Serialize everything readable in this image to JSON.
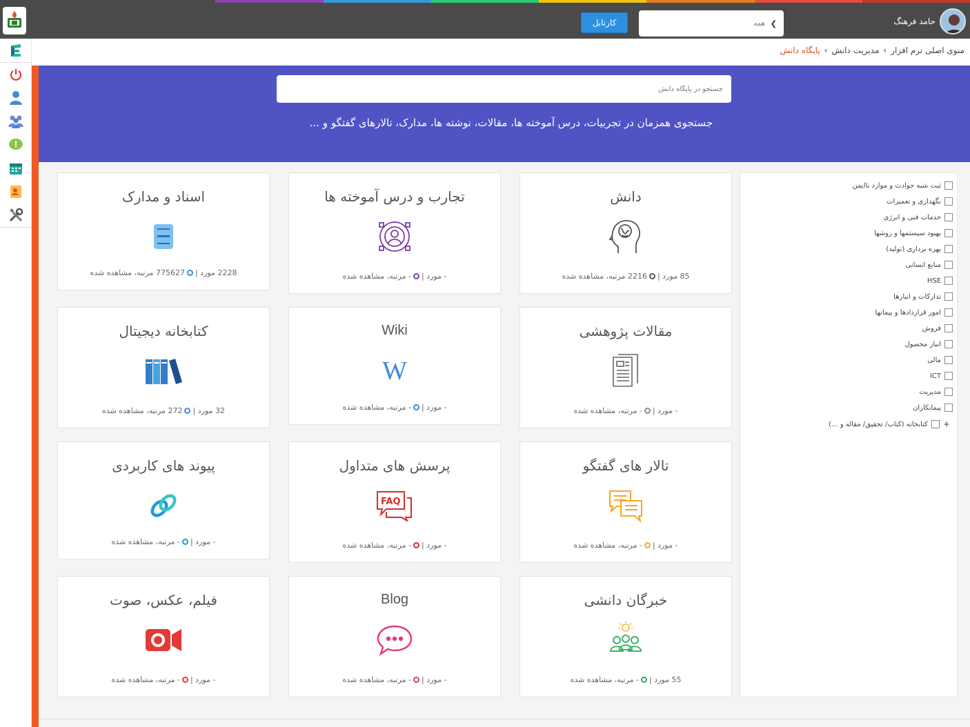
{
  "colors": {
    "rainbow": [
      "#4a4a4a",
      "#8e44ad",
      "#3498db",
      "#2ecc71",
      "#f1c40f",
      "#e67e22",
      "#e74c3c"
    ],
    "hero": "#4f53c3",
    "accent": "#f05a23",
    "cartable_button": "#2d8fe0"
  },
  "topbar": {
    "cartable_label": "کارتابل",
    "search_select": "همه",
    "user_name": "حامد فرهنگ"
  },
  "sidebar": {
    "icons": [
      "app-logo-icon",
      "power-icon",
      "user-icon",
      "users-icon",
      "alert-icon",
      "calendar-icon",
      "contact-card-icon",
      "tools-icon"
    ]
  },
  "breadcrumb": {
    "items": [
      "منوی اصلی نرم افزار",
      "مدیریت دانش",
      "پایگاه دانش"
    ]
  },
  "hero": {
    "search_placeholder": "جستجو در پایگاه دانش",
    "subtitle": "جستجوی همزمان در تجربیات، درس آموخته ها، مقالات، نوشته ها، مدارک، تالارهای گفتگو و ..."
  },
  "cards": [
    {
      "title": "دانش",
      "icon": "brain-head-icon",
      "count": "85",
      "views": "2216"
    },
    {
      "title": "تجارب و درس آموخته ها",
      "icon": "people-network-icon",
      "count": "-",
      "views": "-"
    },
    {
      "title": "اسناد و مدارک",
      "icon": "document-scanner-icon",
      "count": "2228",
      "views": "775627"
    },
    {
      "title": "مقالات پژوهشی",
      "icon": "article-icon",
      "count": "-",
      "views": "-"
    },
    {
      "title": "Wiki",
      "icon": "wikipedia-icon",
      "count": "-",
      "views": "-"
    },
    {
      "title": "کتابخانه دیجیتال",
      "icon": "books-icon",
      "count": "32",
      "views": "272"
    },
    {
      "title": "تالار های گفتگو",
      "icon": "chat-bubbles-icon",
      "count": "-",
      "views": "-"
    },
    {
      "title": "پرسش های متداول",
      "icon": "faq-icon",
      "count": "-",
      "views": "-"
    },
    {
      "title": "پیوند های کاربردی",
      "icon": "link-icon",
      "count": "-",
      "views": "-"
    },
    {
      "title": "خبرگان دانشی",
      "icon": "experts-icon",
      "count": "55",
      "views": "-"
    },
    {
      "title": "Blog",
      "icon": "speech-bubble-icon",
      "count": "-",
      "views": "-"
    },
    {
      "title": "فیلم، عکس، صوت",
      "icon": "video-camera-icon",
      "count": "-",
      "views": "-"
    }
  ],
  "stats_text": {
    "items_unit": "مورد",
    "views_unit": "مرتبه، مشاهده شده",
    "separator": "|"
  },
  "filters": [
    "ثبت شبه حوادث و موارد ناایمن",
    "نگهداری و تعمیرات",
    "خدمات فنی و انرژی",
    "بهبود سیستمها و روشها",
    "بهره برداری (تولید)",
    "منابع انسانی",
    "HSE",
    "تدارکات و انبارها",
    "امور قراردادها و پیمانها",
    "فروش",
    "انبار محصول",
    "مالی",
    "ICT",
    "مدیریت",
    "پیمانکاران",
    "کتابخانه (کتاب/ تحقیق/ مقاله و ...)"
  ],
  "filter_expand": "+"
}
